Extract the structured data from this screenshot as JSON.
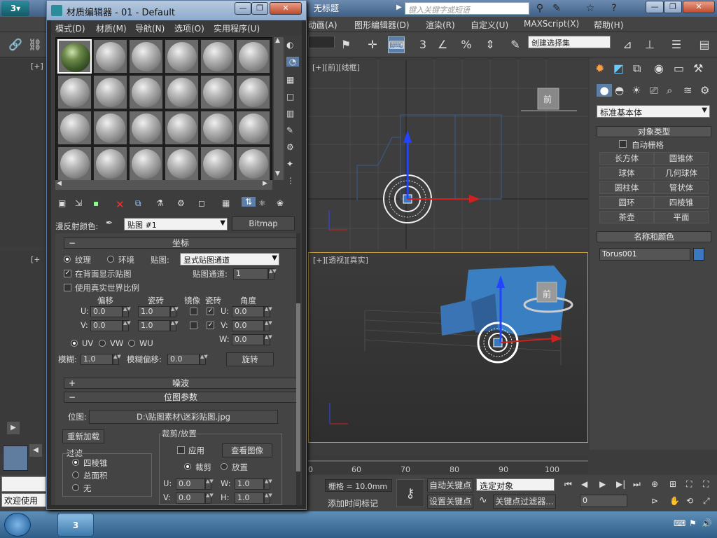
{
  "app": {
    "title": "无标题",
    "search_placeholder": "键入关键字或短语",
    "menu": [
      "动画(A)",
      "图形编辑器(D)",
      "渲染(R)",
      "自定义(U)",
      "MAXScript(X)",
      "帮助(H)"
    ],
    "selection_set_placeholder": "创建选择集"
  },
  "viewports": {
    "front_label": "[+][前][线框]",
    "persp_label": "[+][透视][真实]",
    "nav_cube_front": "前",
    "left_label_top": "[+]",
    "left_label_bottom": "[+"
  },
  "command_panel": {
    "category": "标准基本体",
    "rollout_object_type": "对象类型",
    "auto_grid": "自动栅格",
    "buttons": [
      "长方体",
      "圆锥体",
      "球体",
      "几何球体",
      "圆柱体",
      "管状体",
      "圆环",
      "四棱锥",
      "茶壶",
      "平面"
    ],
    "rollout_name_color": "名称和颜色",
    "object_name": "Torus001",
    "object_color": "#3a78c0"
  },
  "timeline": {
    "ticks": [
      "0",
      "60",
      "70",
      "80",
      "90",
      "100"
    ]
  },
  "statusbar": {
    "grid": "栅格 = 10.0mm",
    "add_time_tag": "添加时间标记",
    "auto_key": "自动关键点",
    "set_key": "设置关键点",
    "selected_object": "选定对象",
    "key_filters": "关键点过滤器...",
    "frame": "0",
    "welcome": "欢迎使用"
  },
  "material_editor": {
    "title": "材质编辑器 - 01 - Default",
    "menu": [
      "模式(D)",
      "材质(M)",
      "导航(N)",
      "选项(O)",
      "实用程序(U)"
    ],
    "diffuse_label": "漫反射颜色:",
    "map_name": "贴图 #1",
    "map_type": "Bitmap",
    "coords": {
      "header": "坐标",
      "texture": "纹理",
      "environ": "环境",
      "mapping_label": "贴图:",
      "mapping_value": "显式贴图通道",
      "show_map_on_back": "在背面显示贴图",
      "map_channel_label": "贴图通道:",
      "map_channel_value": "1",
      "real_world": "使用真实世界比例",
      "offset": "偏移",
      "tiling": "瓷砖",
      "mirror": "镜像",
      "tile": "瓷砖",
      "angle": "角度",
      "u_label": "U:",
      "v_label": "V:",
      "w_label": "W:",
      "u_offset": "0.0",
      "v_offset": "0.0",
      "u_tiling": "1.0",
      "v_tiling": "1.0",
      "u_angle": "0.0",
      "v_angle": "0.0",
      "w_angle": "0.0",
      "uv": "UV",
      "vw": "VW",
      "wu": "WU",
      "blur_label": "模糊:",
      "blur_value": "1.0",
      "blur_offset_label": "模糊偏移:",
      "blur_offset_value": "0.0",
      "rotate": "旋转"
    },
    "noise_header": "噪波",
    "bitmap_params": {
      "header": "位图参数",
      "bitmap_label": "位图:",
      "bitmap_path": "D:\\贴图素材\\迷彩贴图.jpg",
      "reload": "重新加载",
      "crop_place": "裁剪/放置",
      "apply": "应用",
      "view_image": "查看图像",
      "crop": "裁剪",
      "place": "放置",
      "filter": "过滤",
      "pyramidal": "四棱锥",
      "summed_area": "总面积",
      "none": "无",
      "u_label": "U:",
      "v_label": "V:",
      "w_label": "W:",
      "h_label": "H:",
      "u_value": "0.0",
      "v_value": "0.0",
      "w_value": "1.0",
      "h_value": "1.0"
    }
  }
}
